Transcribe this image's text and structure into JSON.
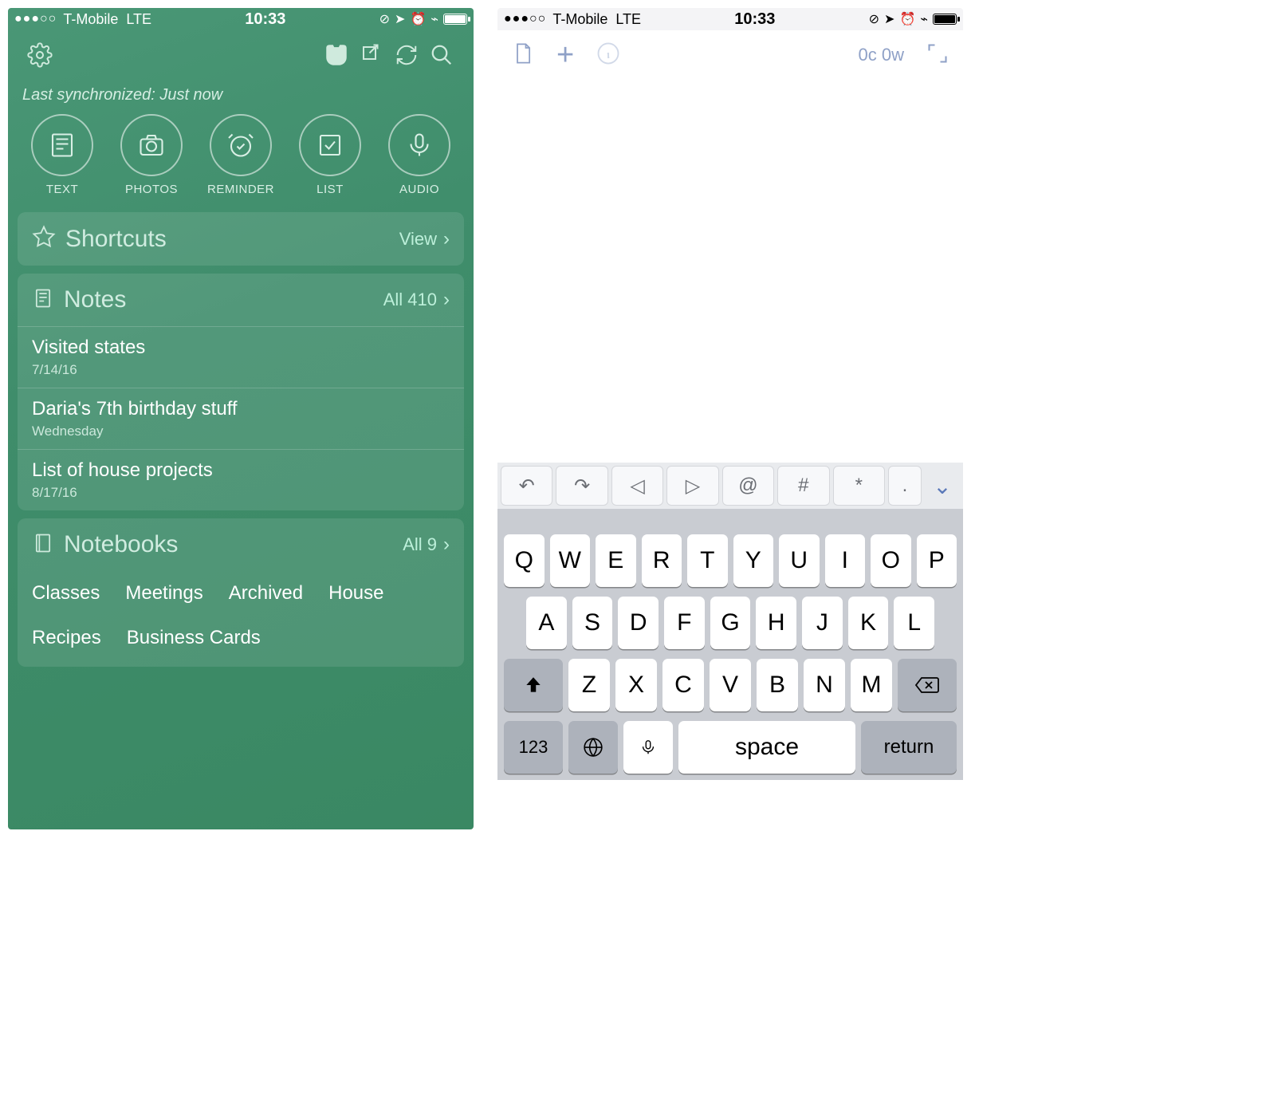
{
  "statusbar": {
    "carrier": "T-Mobile",
    "network": "LTE",
    "time": "10:33",
    "signal_dots": "●●●○○"
  },
  "evernote": {
    "sync_label": "Last synchronized: Just now",
    "quick": {
      "text": "TEXT",
      "photos": "PHOTOS",
      "reminder": "REMINDER",
      "list": "LIST",
      "audio": "AUDIO"
    },
    "shortcuts": {
      "title": "Shortcuts",
      "action": "View"
    },
    "notes": {
      "title": "Notes",
      "action": "All 410",
      "items": [
        {
          "title": "Visited states",
          "date": "7/14/16"
        },
        {
          "title": "Daria's 7th birthday stuff",
          "date": "Wednesday"
        },
        {
          "title": "List of house projects",
          "date": "8/17/16"
        }
      ]
    },
    "notebooks": {
      "title": "Notebooks",
      "action": "All 9",
      "tags": [
        "Classes",
        "Meetings",
        "Archived",
        "House",
        "Recipes",
        "Business Cards"
      ]
    }
  },
  "editor": {
    "wordcount": "0c 0w",
    "acc": {
      "at": "@",
      "hash": "#",
      "star": "*",
      "dot": "."
    }
  },
  "keyboard": {
    "row1": [
      "Q",
      "W",
      "E",
      "R",
      "T",
      "Y",
      "U",
      "I",
      "O",
      "P"
    ],
    "row2": [
      "A",
      "S",
      "D",
      "F",
      "G",
      "H",
      "J",
      "K",
      "L"
    ],
    "row3": [
      "Z",
      "X",
      "C",
      "V",
      "B",
      "N",
      "M"
    ],
    "numkey": "123",
    "space": "space",
    "return": "return"
  }
}
